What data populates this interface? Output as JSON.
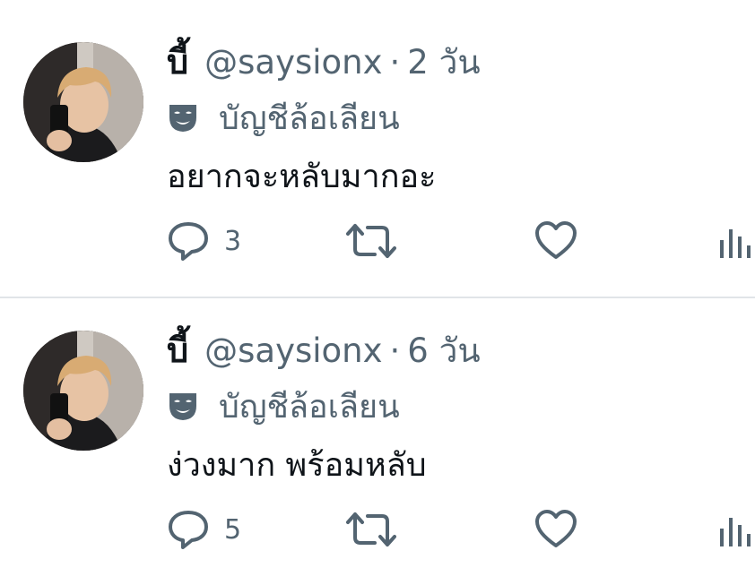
{
  "colors": {
    "text_primary": "#0f1419",
    "text_secondary": "#536471",
    "divider": "#e1e4e8",
    "background": "#ffffff"
  },
  "tweets": [
    {
      "display_name": "บี้",
      "handle": "@saysionx",
      "separator": "·",
      "time": "2 วัน",
      "badge_icon": "theater-mask-icon",
      "badge_label": "บัญชีล้อเลียน",
      "text": "อยากจะหลับมากอะ",
      "reply_count": "3",
      "icons": [
        "reply-icon",
        "retweet-icon",
        "like-icon",
        "views-icon"
      ]
    },
    {
      "display_name": "บี้",
      "handle": "@saysionx",
      "separator": "·",
      "time": "6 วัน",
      "badge_icon": "theater-mask-icon",
      "badge_label": "บัญชีล้อเลียน",
      "text": "ง่วงมาก พร้อมหลับ",
      "reply_count": "5",
      "icons": [
        "reply-icon",
        "retweet-icon",
        "like-icon",
        "views-icon"
      ]
    }
  ]
}
